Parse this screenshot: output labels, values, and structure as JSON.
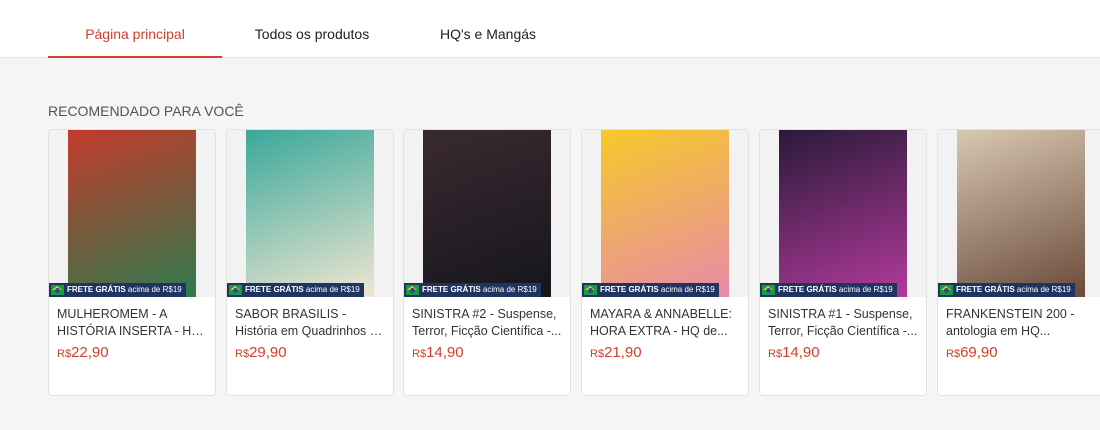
{
  "nav": {
    "tabs": [
      {
        "label": "Página principal",
        "active": true
      },
      {
        "label": "Todos os produtos"
      },
      {
        "label": "HQ's e Mangás"
      }
    ]
  },
  "section": {
    "title": "RECOMENDADO PARA VOCÊ"
  },
  "badge": {
    "main": "FRETE GRÁTIS",
    "sub": "acima de R$19"
  },
  "products": [
    {
      "title": "MULHEROMEM - A HISTÓRIA INSERTA - HQ de...",
      "currency": "R$",
      "price": "22,90",
      "colors": [
        "#c33a2c",
        "#2f7a4d"
      ]
    },
    {
      "title": "SABOR BRASILIS - História em Quadrinhos de Pablo...",
      "currency": "R$",
      "price": "29,90",
      "colors": [
        "#3aa89b",
        "#f0e6d2"
      ]
    },
    {
      "title": "SINISTRA #2 - Suspense, Terror, Ficção Científica -...",
      "currency": "R$",
      "price": "14,90",
      "colors": [
        "#3a2a30",
        "#15151c"
      ]
    },
    {
      "title": "MAYARA & ANNABELLE: HORA EXTRA - HQ de...",
      "currency": "R$",
      "price": "21,90",
      "colors": [
        "#f6c92a",
        "#e88aa8"
      ]
    },
    {
      "title": "SINISTRA #1 - Suspense, Terror, Ficção Científica -...",
      "currency": "R$",
      "price": "14,90",
      "colors": [
        "#2a1a3a",
        "#b23a9a"
      ]
    },
    {
      "title": "FRANKENSTEIN 200 - antologia em HQ...",
      "currency": "R$",
      "price": "69,90",
      "colors": [
        "#d8c8b2",
        "#6a4a3a"
      ]
    }
  ]
}
